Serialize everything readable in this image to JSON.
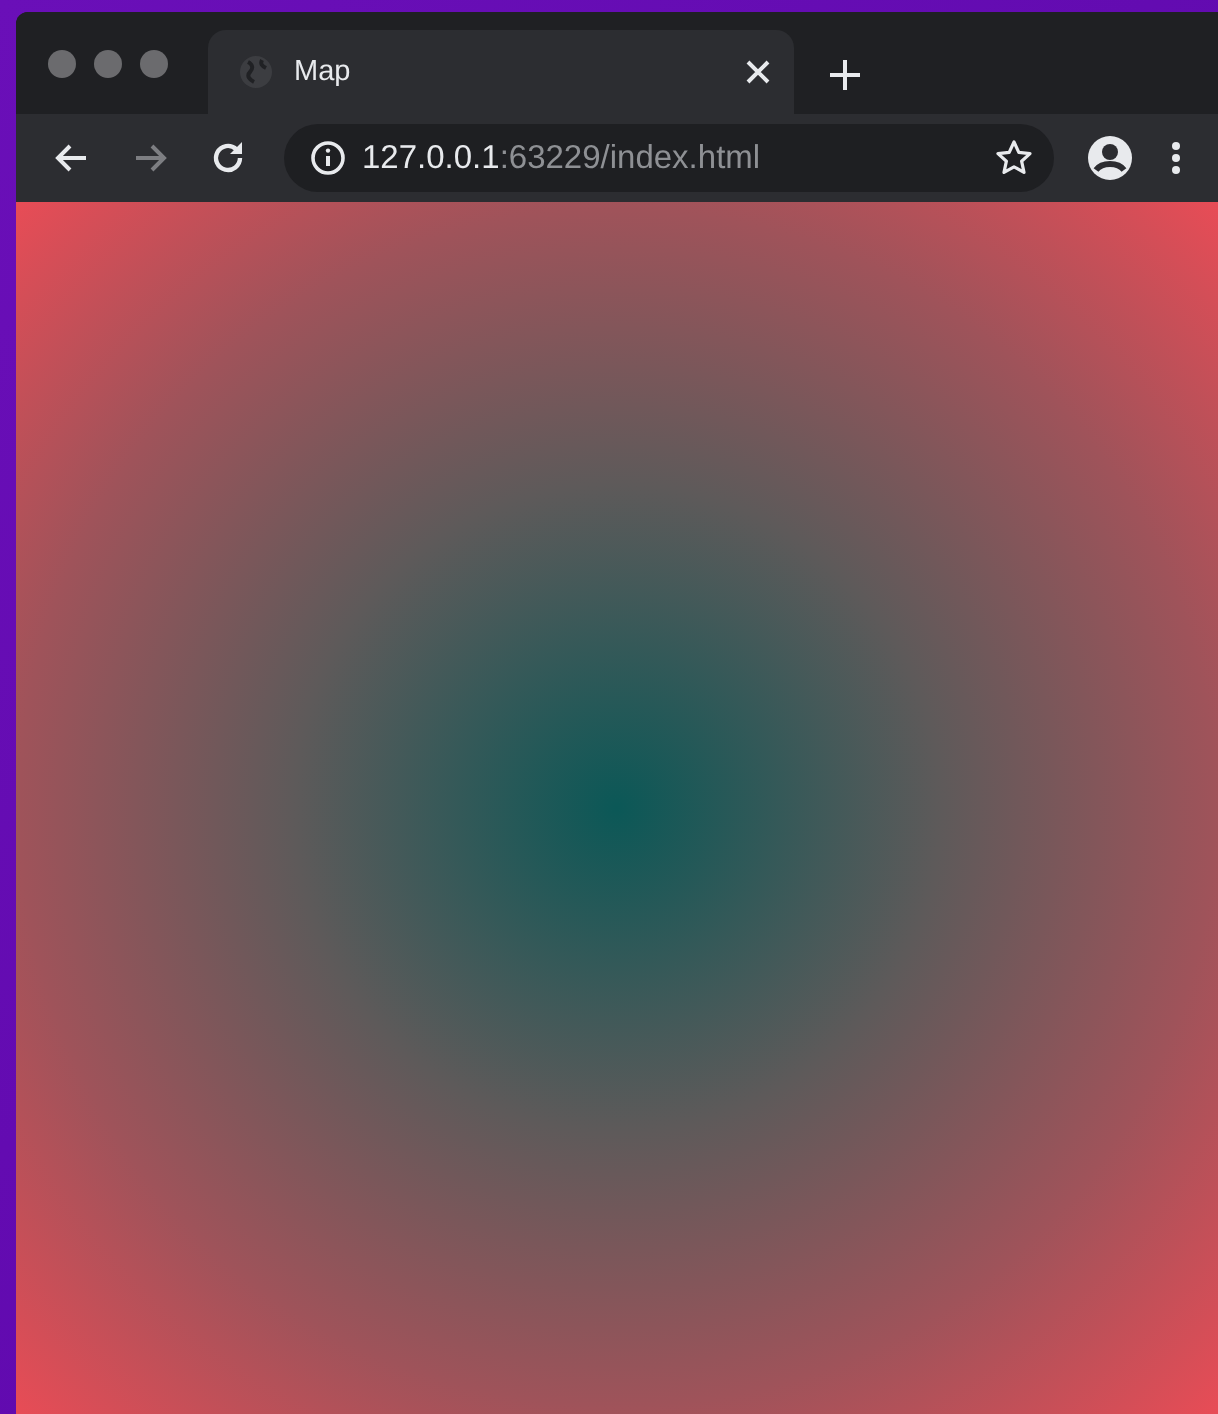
{
  "tabs": [
    {
      "title": "Map",
      "selected": true
    }
  ],
  "nav_buttons": [
    {
      "kind": "back",
      "disabled": false
    },
    {
      "kind": "forward",
      "disabled": true
    },
    {
      "kind": "reload",
      "disabled": false
    }
  ],
  "address": {
    "host": "127.0.0.1",
    "path": ":63229/index.html"
  }
}
